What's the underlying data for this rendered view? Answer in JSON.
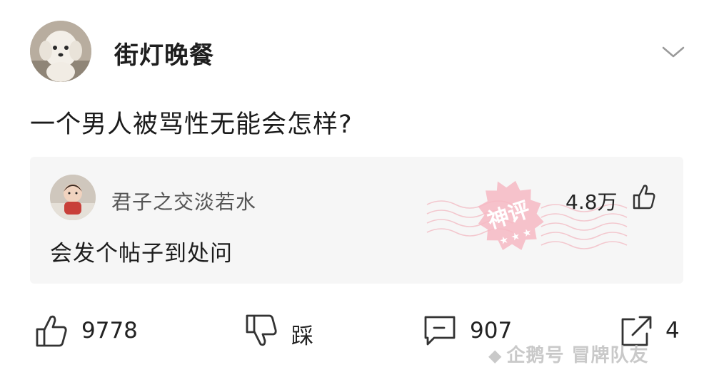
{
  "post": {
    "author": "街灯晚餐",
    "text": "一个男人被骂性无能会怎样?"
  },
  "comment": {
    "author": "君子之交淡若水",
    "text": "会发个帖子到处问",
    "likes": "4.8万",
    "badge": "神评"
  },
  "actions": {
    "like_count": "9778",
    "dislike_label": "踩",
    "comment_count": "907",
    "share_count": "4"
  },
  "watermark": "企鹅号 冒牌队友",
  "icons": {
    "chevron": "chevron-down-icon",
    "like": "thumbs-up-icon",
    "dislike": "thumbs-down-icon",
    "comment": "comment-icon",
    "share": "share-icon"
  },
  "colors": {
    "card_bg": "#f6f6f6",
    "stamp": "#f0a6b1"
  }
}
